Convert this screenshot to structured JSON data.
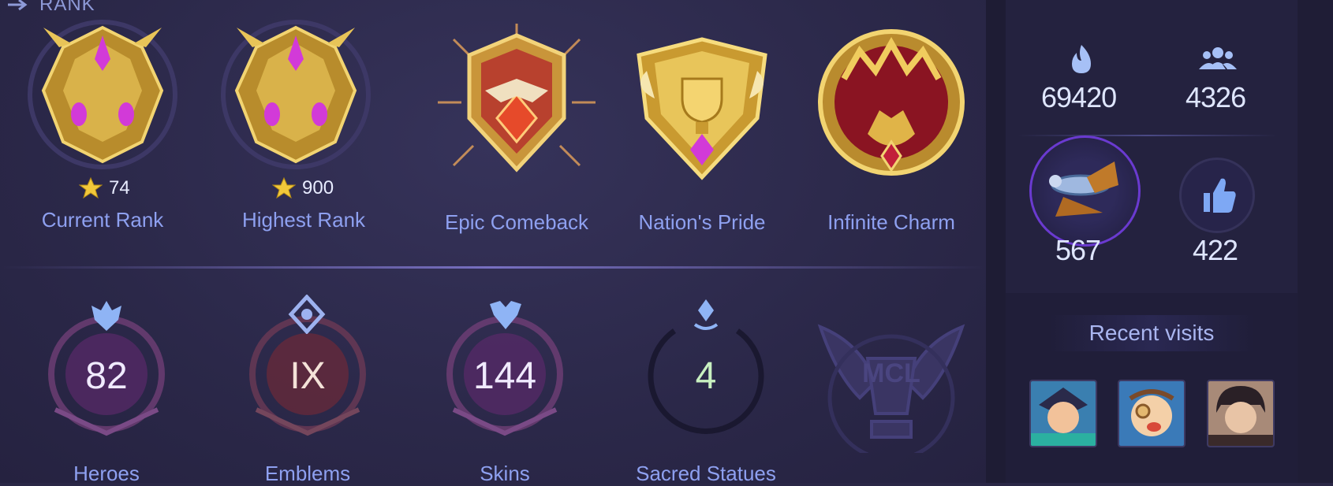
{
  "header": {
    "title": "RANK"
  },
  "ranks": [
    {
      "id": "current",
      "stars": "74",
      "label": "Current Rank"
    },
    {
      "id": "highest",
      "stars": "900",
      "label": "Highest Rank"
    }
  ],
  "achievements": [
    {
      "id": "epic-comeback",
      "label": "Epic Comeback"
    },
    {
      "id": "nations-pride",
      "label": "Nation's Pride"
    },
    {
      "id": "infinite-charm",
      "label": "Infinite Charm"
    }
  ],
  "collection": [
    {
      "id": "heroes",
      "value": "82",
      "label": "Heroes"
    },
    {
      "id": "emblems",
      "value": "IX",
      "label": "Emblems"
    },
    {
      "id": "skins",
      "value": "144",
      "label": "Skins"
    },
    {
      "id": "sacred-statues",
      "value": "4",
      "label": "Sacred Statues"
    }
  ],
  "mcl_badge": {
    "text": "MCL"
  },
  "side_stats": {
    "popularity": "69420",
    "followers": "4326",
    "collection_score": "567",
    "likes": "422"
  },
  "recent_visits": {
    "title": "Recent visits"
  },
  "colors": {
    "background": "#2a2746",
    "label": "#8ea0f0",
    "gold": "#d8b24a",
    "magenta": "#d23ad8"
  }
}
